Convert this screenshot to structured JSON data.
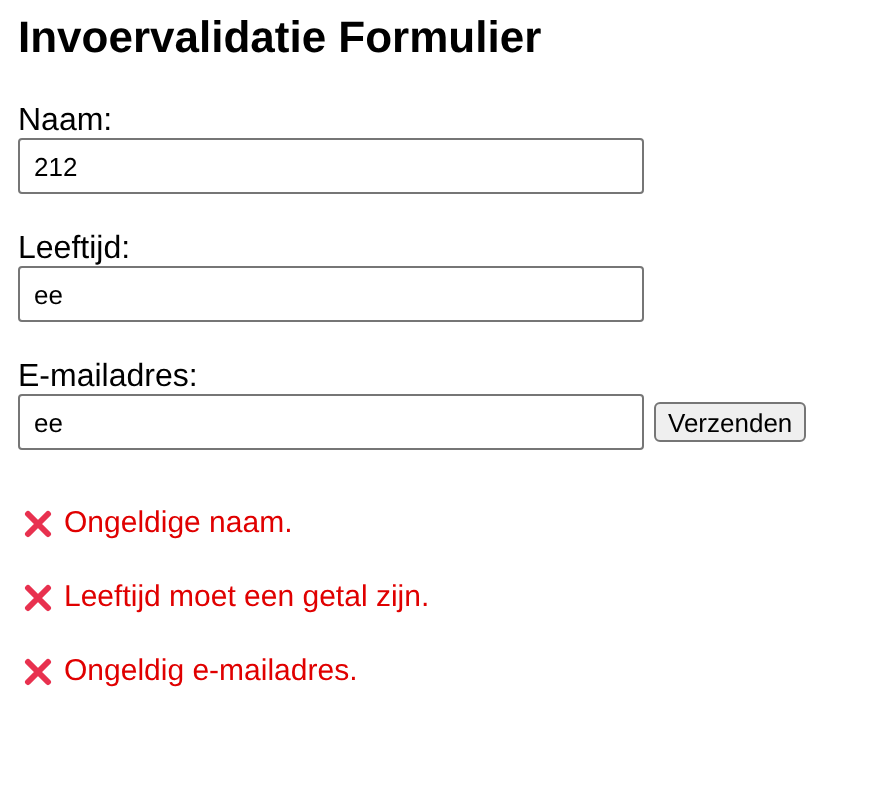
{
  "title": "Invoervalidatie Formulier",
  "fields": [
    {
      "label": "Naam:",
      "value": "212"
    },
    {
      "label": "Leeftijd:",
      "value": "ee"
    },
    {
      "label": "E-mailadres:",
      "value": "ee"
    }
  ],
  "submit_button": "Verzenden",
  "errors": [
    "Ongeldige naam.",
    "Leeftijd moet een getal zijn.",
    "Ongeldig e-mailadres."
  ]
}
